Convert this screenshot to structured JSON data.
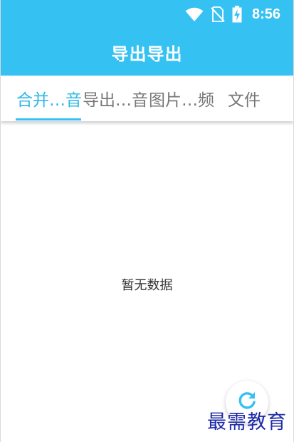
{
  "status_bar": {
    "time": "8:56",
    "icons": [
      "wifi-icon",
      "no-sim-icon",
      "battery-charging-icon"
    ]
  },
  "app_bar": {
    "title": "导出导出"
  },
  "tabs": [
    {
      "label": "合并…音",
      "active": true
    },
    {
      "label": "导出…音",
      "active": false
    },
    {
      "label": "图片…频",
      "active": false
    },
    {
      "label": "文件",
      "active": false
    }
  ],
  "content": {
    "empty_text": "暂无数据"
  },
  "fab": {
    "icon": "refresh-icon"
  },
  "watermark": {
    "text": "最需教育"
  },
  "colors": {
    "primary": "#35c1f2",
    "tab_active": "#2fb8e8",
    "tab_inactive": "#777777",
    "watermark": "#1e2aa8"
  }
}
